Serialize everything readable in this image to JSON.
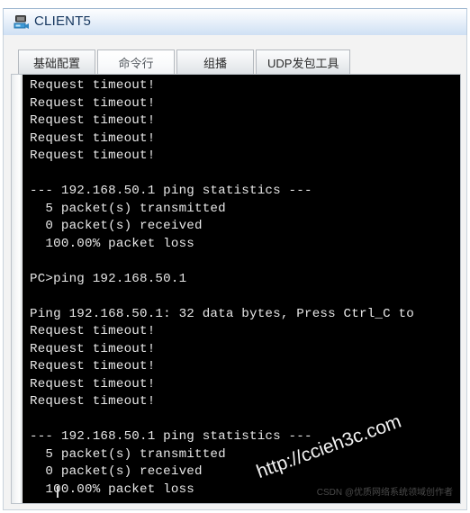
{
  "window": {
    "title": "CLIENT5",
    "icon": "network-pc-icon"
  },
  "tabs": [
    {
      "label": "基础配置",
      "active": false
    },
    {
      "label": "命令行",
      "active": true
    },
    {
      "label": "组播",
      "active": false
    },
    {
      "label": "UDP发包工具",
      "active": false
    }
  ],
  "terminal": {
    "lines": [
      "Request timeout!",
      "Request timeout!",
      "Request timeout!",
      "Request timeout!",
      "Request timeout!",
      "",
      "--- 192.168.50.1 ping statistics ---",
      "  5 packet(s) transmitted",
      "  0 packet(s) received",
      "  100.00% packet loss",
      "",
      "PC>ping 192.168.50.1",
      "",
      "Ping 192.168.50.1: 32 data bytes, Press Ctrl_C to",
      "Request timeout!",
      "Request timeout!",
      "Request timeout!",
      "Request timeout!",
      "Request timeout!",
      "",
      "--- 192.168.50.1 ping statistics ---",
      "  5 packet(s) transmitted",
      "  0 packet(s) received",
      "  100.00% packet loss",
      ""
    ]
  },
  "watermarks": {
    "site": "http://ccieh3c.com",
    "csdn": "CSDN @优质网络系统领域创作者"
  },
  "colors": {
    "title_bar_accent": "#cfe0f4",
    "title_text": "#15365e",
    "terminal_bg": "#000000",
    "terminal_fg": "#e8e8e8",
    "tab_border": "#b4b9bf"
  }
}
